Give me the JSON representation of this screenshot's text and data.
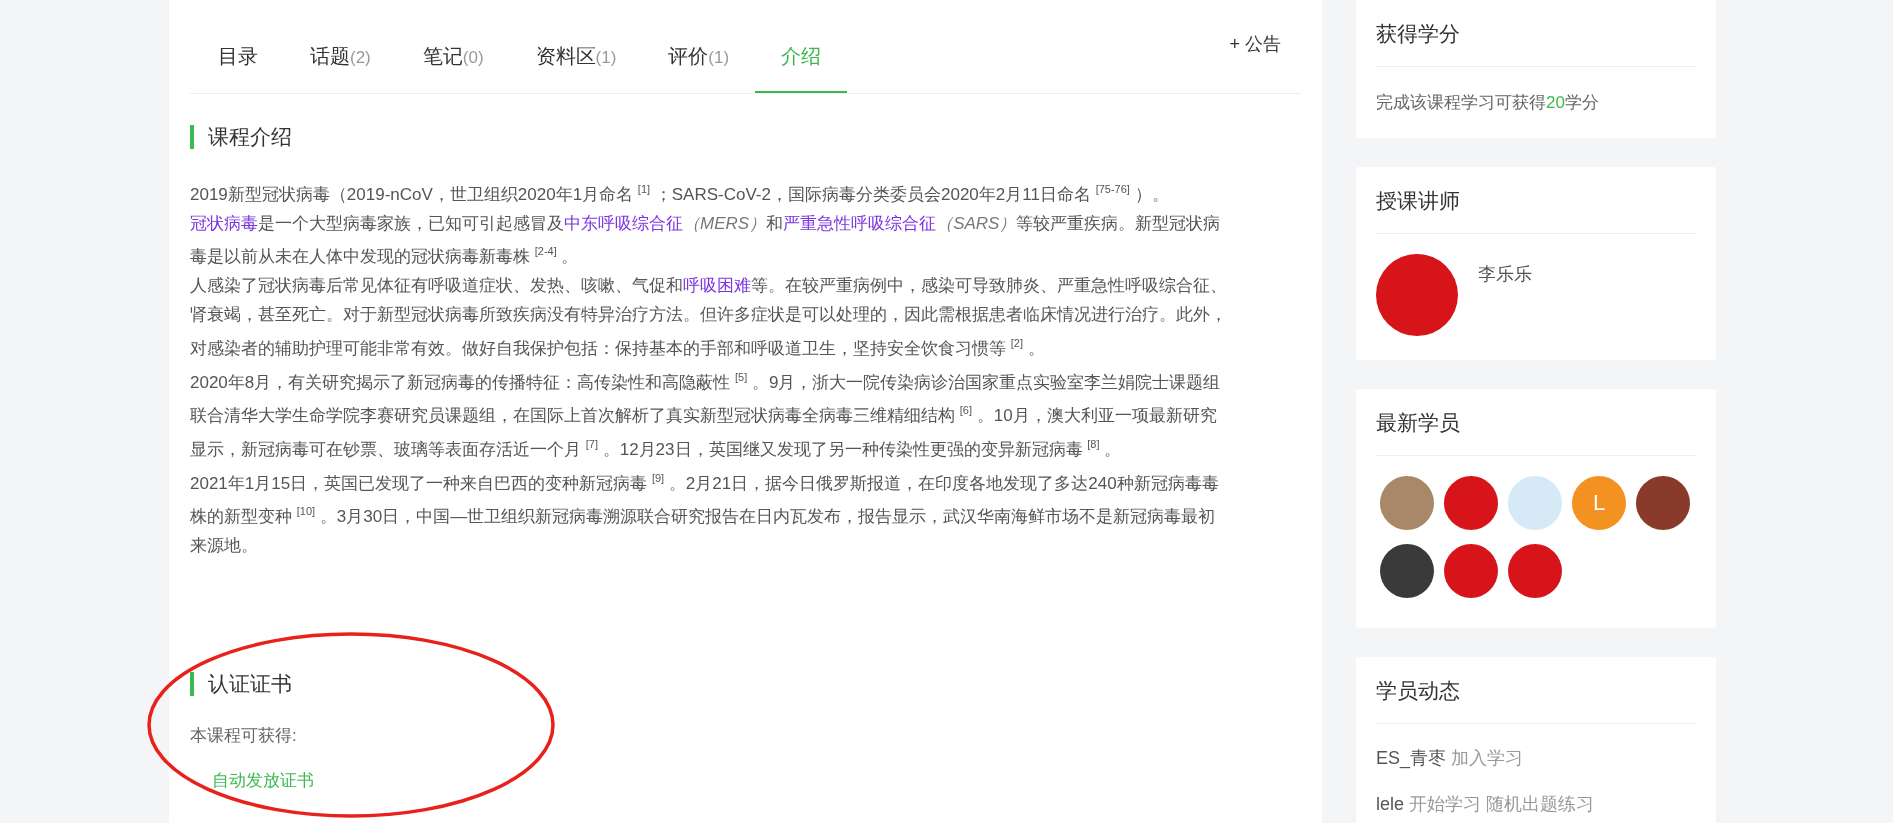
{
  "tabs": [
    {
      "label": "目录",
      "selected": false
    },
    {
      "label": "话题",
      "count": "(2)",
      "selected": false
    },
    {
      "label": "笔记",
      "count": "(0)",
      "selected": false
    },
    {
      "label": "资料区",
      "count": "(1)",
      "selected": false
    },
    {
      "label": "评价",
      "count": "(1)",
      "selected": false
    },
    {
      "label": "介绍",
      "selected": true
    }
  ],
  "announce_button": "+ 公告",
  "intro": {
    "title": "课程介绍",
    "paragraphs": [
      [
        {
          "kind": "text",
          "text": "2019新型冠状病毒（2019-nCoV，世卫组织2020年1月命名 $^{[1]}$ ；SARS-CoV-2，国际病毒分类委员会2020年2月11日命名 $^{[75-76]}$ ）。"
        }
      ],
      [
        {
          "kind": "link",
          "text": "冠状病毒"
        },
        {
          "kind": "text",
          "text": "是一个大型病毒家族，已知可引起感冒及"
        },
        {
          "kind": "link",
          "text": "中东呼吸综合征"
        },
        {
          "kind": "italic",
          "text": "（MERS）"
        },
        {
          "kind": "text",
          "text": "和"
        },
        {
          "kind": "link",
          "text": "严重急性呼吸综合征"
        },
        {
          "kind": "italic",
          "text": "（SARS）"
        },
        {
          "kind": "text",
          "text": "等较严重疾病。新型冠状病毒是以前从未在人体中发现的冠状病毒新毒株 $^{[2-4]}$ 。"
        }
      ],
      [
        {
          "kind": "text",
          "text": "人感染了冠状病毒后常见体征有呼吸道症状、发热、咳嗽、气促和"
        },
        {
          "kind": "link",
          "text": "呼吸困难"
        },
        {
          "kind": "text",
          "text": "等。在较严重病例中，感染可导致肺炎、严重急性呼吸综合征、肾衰竭，甚至死亡。对于新型冠状病毒所致疾病没有特异治疗方法。但许多症状是可以处理的，因此需根据患者临床情况进行治疗。此外，对感染者的辅助护理可能非常有效。做好自我保护包括：保持基本的手部和呼吸道卫生，坚持安全饮食习惯等 $^{[2]}$ 。"
        }
      ],
      [
        {
          "kind": "text",
          "text": "2020年8月，有关研究揭示了新冠病毒的传播特征：高传染性和高隐蔽性 $^{[5]}$ 。9月，浙大一院传染病诊治国家重点实验室李兰娟院士课题组联合清华大学生命学院李赛研究员课题组，在国际上首次解析了真实新型冠状病毒全病毒三维精细结构 $^{[6]}$ 。10月，澳大利亚一项最新研究显示，新冠病毒可在钞票、玻璃等表面存活近一个月 $^{[7]}$ 。12月23日，英国继又发现了另一种传染性更强的变异新冠病毒 $^{[8]}$ 。"
        }
      ],
      [
        {
          "kind": "text",
          "text": "2021年1月15日，英国已发现了一种来自巴西的变种新冠病毒 $^{[9]}$ 。2月21日，据今日俄罗斯报道，在印度各地发现了多达240种新冠病毒毒株的新型变种 $^{[10]}$ 。3月30日，中国—世卫组织新冠病毒溯源联合研究报告在日内瓦发布，报告显示，武汉华南海鲜市场不是新冠病毒最初来源地。"
        }
      ]
    ]
  },
  "certificate": {
    "title": "认证证书",
    "label": "本课程可获得:",
    "link": "自动发放证书"
  },
  "credits": {
    "title": "获得学分",
    "text_before": "完成该课程学习可获得",
    "points": "20",
    "text_after": "学分"
  },
  "teacher": {
    "title": "授课讲师",
    "name": "李乐乐"
  },
  "students": {
    "title": "最新学员",
    "avatars": [
      {
        "kind": "photo",
        "color": "#a88868"
      },
      {
        "kind": "photo",
        "color": "#d7141a"
      },
      {
        "kind": "photo",
        "color": "#d6e9f6"
      },
      {
        "kind": "letter",
        "letter": "L",
        "color": "#f39220"
      },
      {
        "kind": "photo",
        "color": "#8a3a2a"
      },
      {
        "kind": "photo",
        "color": "#3a3a3a"
      },
      {
        "kind": "photo",
        "color": "#d7141a"
      },
      {
        "kind": "photo",
        "color": "#d7141a"
      }
    ]
  },
  "activity": {
    "title": "学员动态",
    "entries": [
      {
        "user": "ES_青枣",
        "action": "加入学习"
      },
      {
        "user": "lele",
        "action": "开始学习 随机出题练习"
      }
    ]
  }
}
